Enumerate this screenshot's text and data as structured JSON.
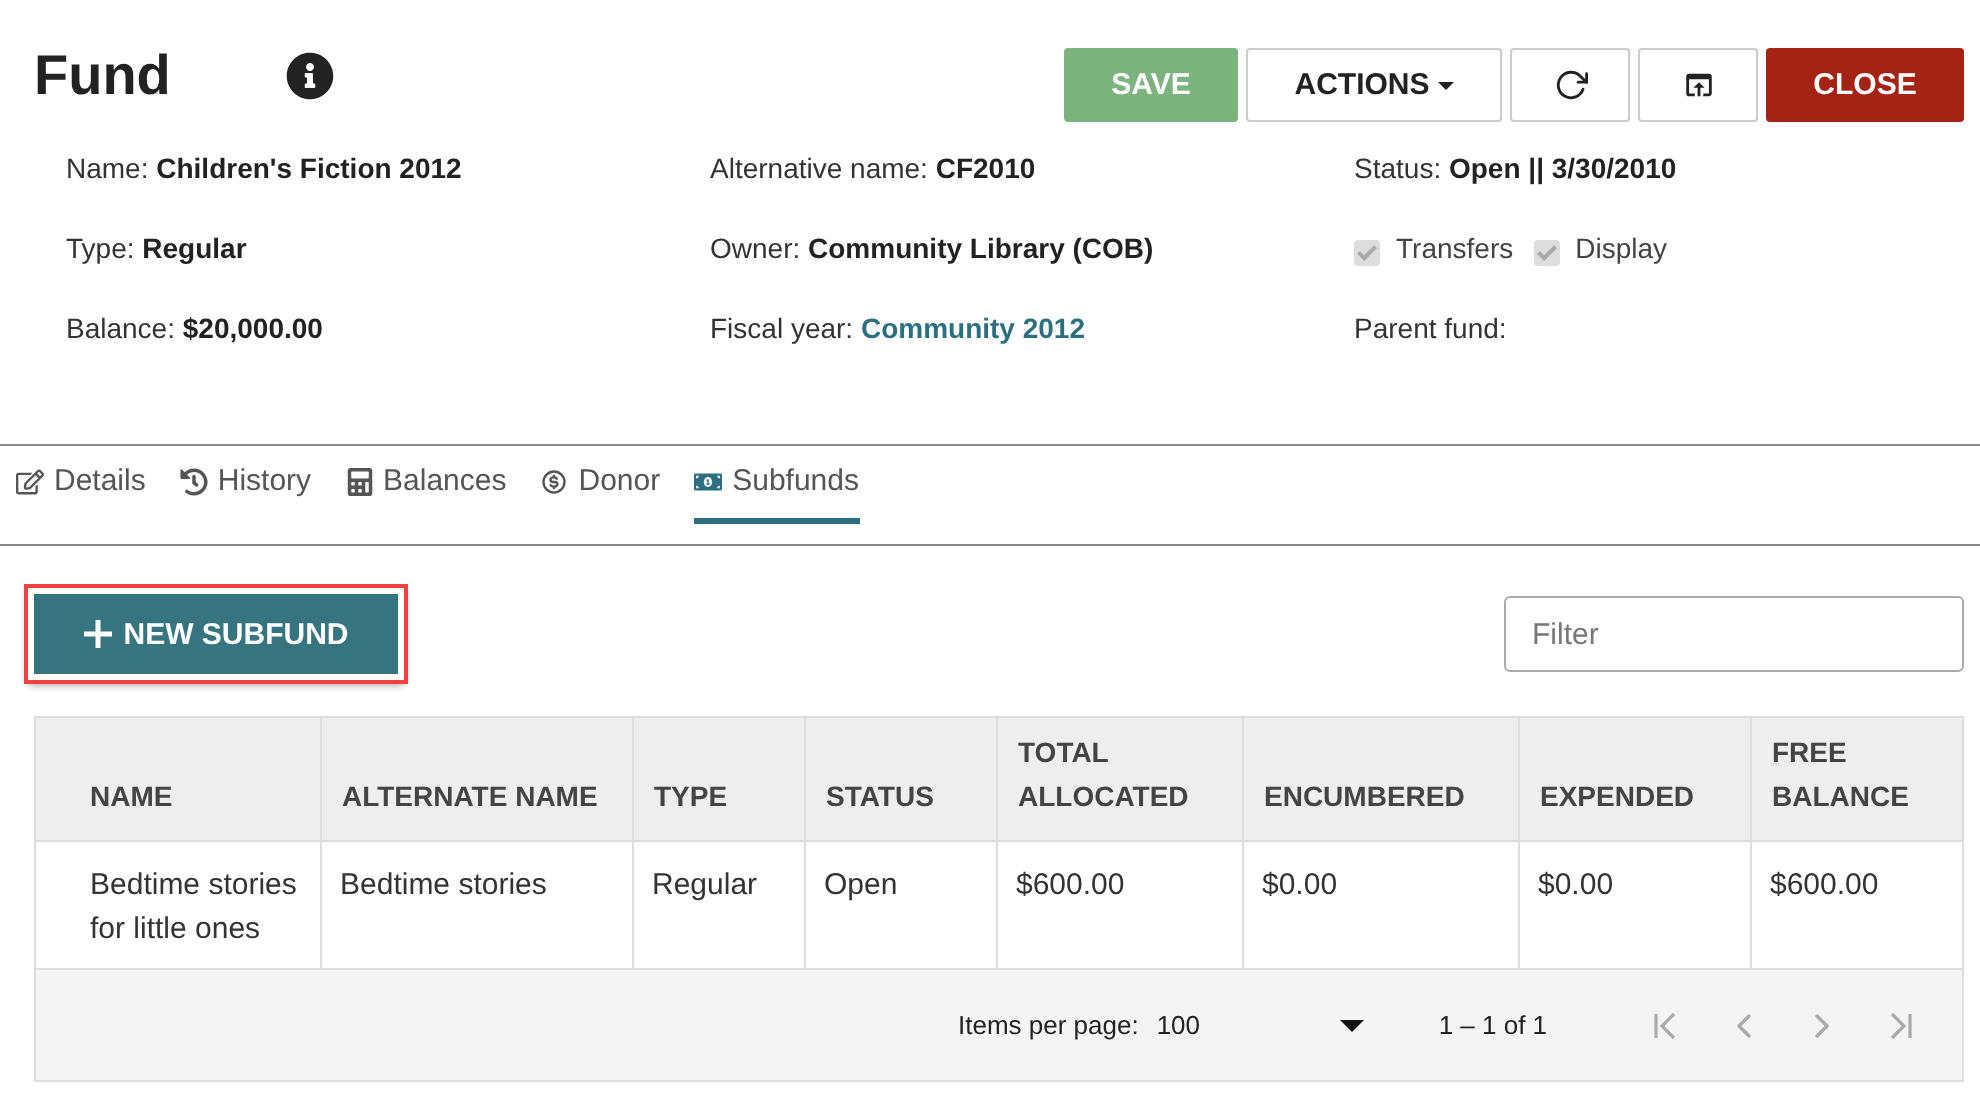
{
  "title": "Fund",
  "actions": [
    {
      "label": "SAVE",
      "kind": "save"
    },
    {
      "label": "ACTIONS",
      "kind": "menu"
    },
    {
      "kind": "refresh"
    },
    {
      "kind": "open"
    },
    {
      "label": "CLOSE",
      "kind": "close"
    }
  ],
  "fields": [
    {
      "label": "Name:",
      "value": "Children's Fiction 2012",
      "kind": "text"
    },
    {
      "label": "Alternative name:",
      "value": "CF2010",
      "kind": "text"
    },
    {
      "label": "Status:",
      "value": "Open || 3/30/2010",
      "kind": "text"
    },
    {
      "label": "Type:",
      "value": "Regular",
      "kind": "text"
    },
    {
      "label": "Owner:",
      "value": "Community Library (COB)",
      "kind": "text"
    },
    {
      "kind": "checks",
      "checks": [
        {
          "label": "Transfers",
          "checked": true,
          "disabled": true
        },
        {
          "label": "Display",
          "checked": true,
          "disabled": true
        }
      ]
    },
    {
      "label": "Balance:",
      "value": "$20,000.00",
      "kind": "text"
    },
    {
      "label": "Fiscal year:",
      "value": "Community 2012",
      "kind": "link"
    },
    {
      "label": "Parent fund:",
      "kind": "text"
    }
  ],
  "tabs": [
    {
      "label": "Details",
      "selected": false
    },
    {
      "label": "History",
      "selected": false
    },
    {
      "label": "Balances",
      "selected": false
    },
    {
      "label": "Donor",
      "selected": false
    },
    {
      "label": "Subfunds",
      "selected": true
    }
  ],
  "new_button": {
    "label": "NEW SUBFUND",
    "highlighted": true
  },
  "filter": {
    "placeholder": "Filter"
  },
  "table": {
    "columns": [
      "NAME",
      "ALTERNATE NAME",
      "TYPE",
      "STATUS",
      "TOTAL ALLOCATED",
      "ENCUMBERED",
      "EXPENDED",
      "FREE BALANCE"
    ],
    "rows": [
      [
        "Bedtime stories for little ones",
        "Bedtime stories",
        "Regular",
        "Open",
        "$600.00",
        "$0.00",
        "$0.00",
        "$600.00"
      ]
    ]
  },
  "paginator": {
    "label": "Items per page:",
    "page_size": "100",
    "range": "1 – 1 of 1",
    "disabled": true
  }
}
